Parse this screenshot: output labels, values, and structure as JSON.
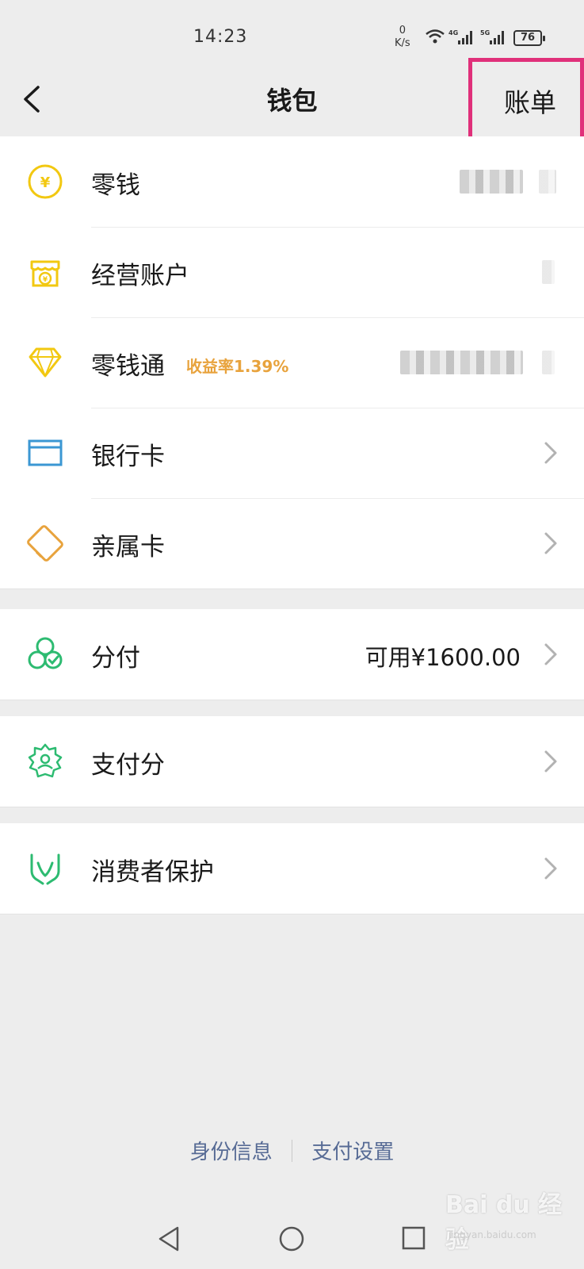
{
  "status_bar": {
    "time": "14:23",
    "net_speed_value": "0",
    "net_speed_unit": "K/s",
    "signal_1": "4G",
    "signal_2": "5G",
    "battery": "76"
  },
  "nav": {
    "title": "钱包",
    "bill_label": "账单",
    "highlight_color": "#e0307a"
  },
  "group1": [
    {
      "label": "零钱",
      "value": "¥1.77",
      "icon": "yuan-coin-icon",
      "color": "#f2c811"
    },
    {
      "label": "经营账户",
      "icon": "store-icon",
      "color": "#f2c811"
    },
    {
      "label": "零钱通",
      "tag": "收益率1.39%",
      "icon": "diamond-icon",
      "color": "#f2c811"
    },
    {
      "label": "银行卡",
      "icon": "card-icon",
      "color": "#3b97d3"
    },
    {
      "label": "亲属卡",
      "icon": "family-card-icon",
      "color": "#e8a33d"
    }
  ],
  "group2": [
    {
      "label": "分付",
      "value": "可用¥1600.00",
      "icon": "fenfu-icon",
      "color": "#2dbb71"
    }
  ],
  "group3": [
    {
      "label": "支付分",
      "icon": "pay-score-icon",
      "color": "#2dbb71"
    }
  ],
  "group4": [
    {
      "label": "消费者保护",
      "icon": "protection-icon",
      "color": "#2dbb71"
    }
  ],
  "footer": {
    "identity_link": "身份信息",
    "payment_settings_link": "支付设置"
  },
  "watermark": {
    "text": "Bai du 经验",
    "sub": "jingyan.baidu.com"
  }
}
